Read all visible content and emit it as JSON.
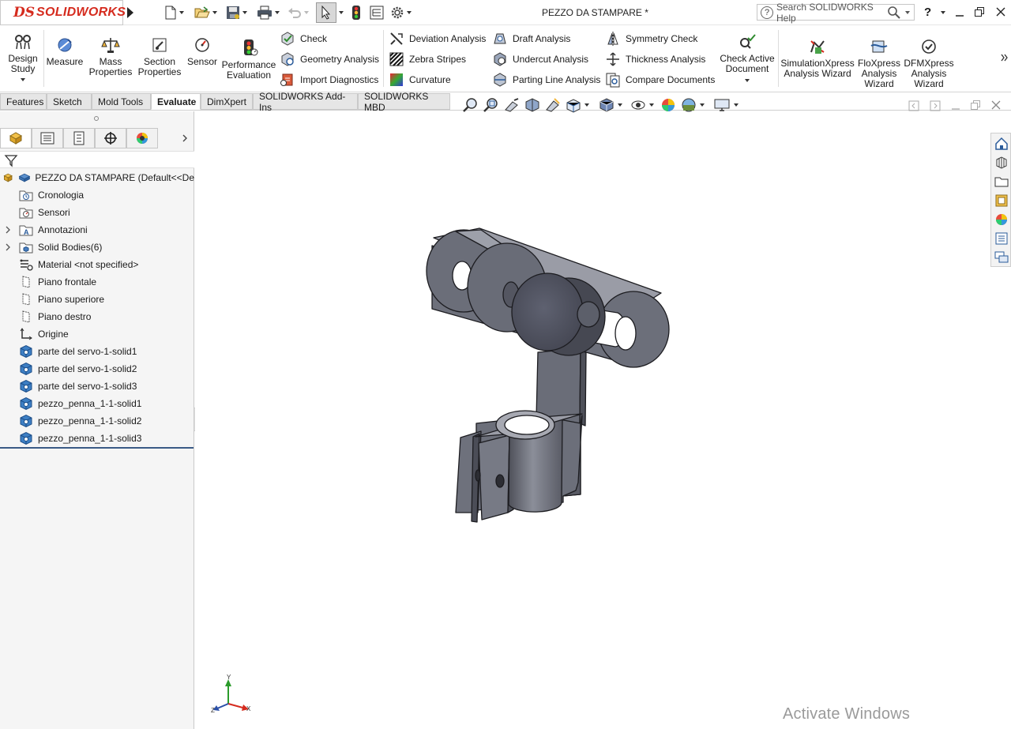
{
  "app": {
    "brand_ds": "DS",
    "brand_name": "SOLIDWORKS",
    "document_title": "PEZZO DA STAMPARE *",
    "search_placeholder": "Search SOLIDWORKS Help",
    "help_symbol": "?"
  },
  "ribbon": {
    "design_study": [
      "Design",
      "Study"
    ],
    "measure": "Measure",
    "mass_properties": [
      "Mass",
      "Properties"
    ],
    "section_properties": [
      "Section",
      "Properties"
    ],
    "sensor": "Sensor",
    "performance_evaluation": [
      "Performance",
      "Evaluation"
    ],
    "check": "Check",
    "geometry_analysis": "Geometry Analysis",
    "import_diagnostics": "Import Diagnostics",
    "deviation_analysis": "Deviation Analysis",
    "zebra_stripes": "Zebra Stripes",
    "curvature": "Curvature",
    "draft_analysis": "Draft Analysis",
    "undercut_analysis": "Undercut Analysis",
    "parting_line_analysis": "Parting Line Analysis",
    "symmetry_check": "Symmetry Check",
    "thickness_analysis": "Thickness Analysis",
    "compare_documents": "Compare Documents",
    "check_active_document": [
      "Check Active",
      "Document"
    ],
    "simulationxpress": [
      "SimulationXpress",
      "Analysis Wizard"
    ],
    "floxpress": [
      "FloXpress",
      "Analysis",
      "Wizard"
    ],
    "dfmxpress": [
      "DFMXpress",
      "Analysis",
      "Wizard"
    ]
  },
  "tabs": [
    "Features",
    "Sketch",
    "Mold Tools",
    "Evaluate",
    "DimXpert",
    "SOLIDWORKS Add-Ins",
    "SOLIDWORKS MBD"
  ],
  "active_tab": "Evaluate",
  "tree": {
    "root": "PEZZO DA STAMPARE  (Default<<De",
    "items": [
      {
        "label": "Cronologia",
        "icon": "history-folder-icon",
        "expandable": false
      },
      {
        "label": "Sensori",
        "icon": "sensor-folder-icon",
        "expandable": false
      },
      {
        "label": "Annotazioni",
        "icon": "annotations-icon",
        "expandable": true
      },
      {
        "label": "Solid Bodies(6)",
        "icon": "solid-bodies-folder-icon",
        "expandable": true
      },
      {
        "label": "Material <not specified>",
        "icon": "material-icon",
        "expandable": false
      },
      {
        "label": "Piano frontale",
        "icon": "plane-icon",
        "expandable": false
      },
      {
        "label": "Piano superiore",
        "icon": "plane-icon",
        "expandable": false
      },
      {
        "label": "Piano destro",
        "icon": "plane-icon",
        "expandable": false
      },
      {
        "label": "Origine",
        "icon": "origin-icon",
        "expandable": false
      },
      {
        "label": "parte del servo-1-solid1",
        "icon": "body-icon",
        "expandable": false
      },
      {
        "label": "parte del servo-1-solid2",
        "icon": "body-icon",
        "expandable": false
      },
      {
        "label": "parte del servo-1-solid3",
        "icon": "body-icon",
        "expandable": false
      },
      {
        "label": "pezzo_penna_1-1-solid1",
        "icon": "body-icon",
        "expandable": false
      },
      {
        "label": "pezzo_penna_1-1-solid2",
        "icon": "body-icon",
        "expandable": false
      },
      {
        "label": "pezzo_penna_1-1-solid3",
        "icon": "body-icon",
        "expandable": false
      }
    ]
  },
  "triad": {
    "x": "X",
    "y": "Y",
    "z": "Z"
  },
  "watermark": "Activate Windows",
  "colors": {
    "brand_red": "#d52b1e",
    "model_gray": "#6c6f7a",
    "model_dark": "#4e5059",
    "model_light": "#9a9ca6",
    "selection_blue": "#2a5b9a"
  }
}
